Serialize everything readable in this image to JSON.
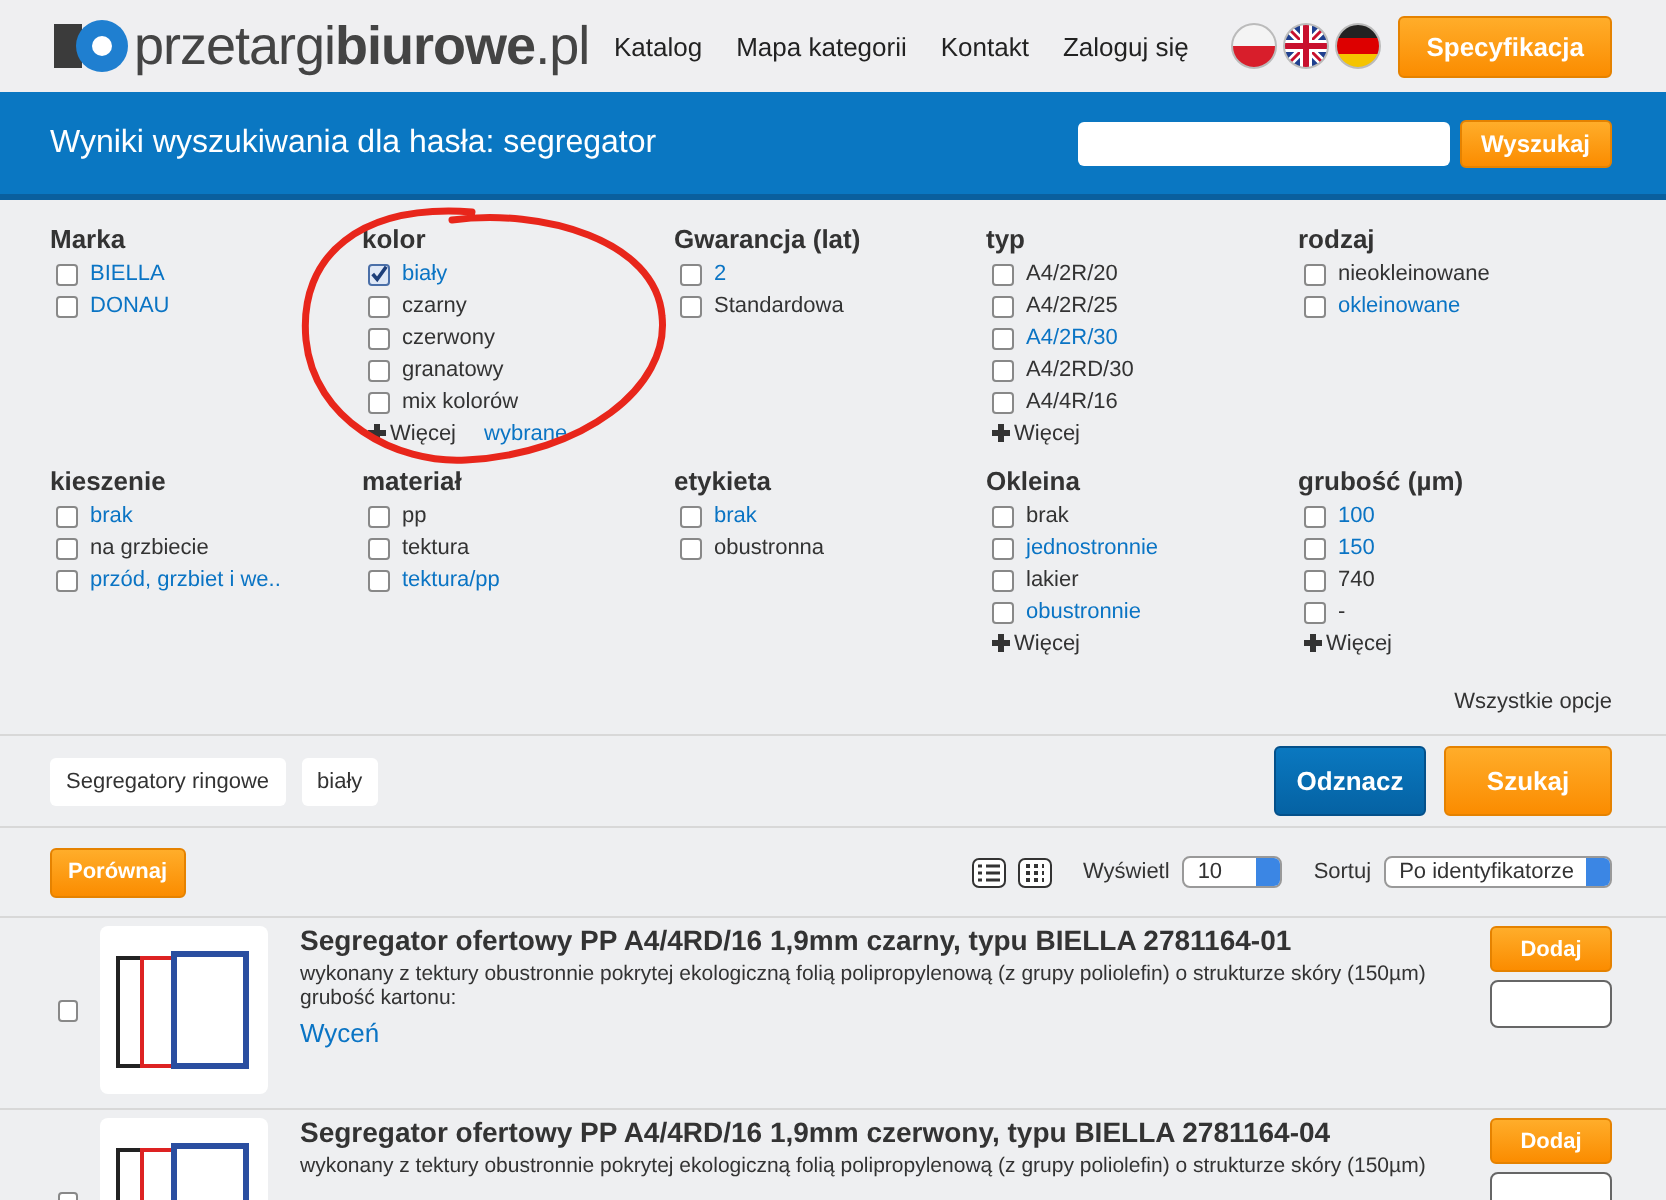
{
  "header": {
    "logo": "przetargi**biurowe**.pl",
    "nav": [
      "Katalog",
      "Mapa kategorii",
      "Kontakt",
      "Zaloguj się"
    ],
    "flags": [
      {
        "kind": "pl"
      },
      {
        "kind": "gb"
      },
      {
        "kind": "de"
      }
    ],
    "spec_button": "Specyfikacja"
  },
  "search_bar": {
    "title": "Wyniki wyszukiwania dla hasła: segregator",
    "button": "Wyszukaj"
  },
  "filters": [
    {
      "title": "Marka",
      "items": [
        {
          "label": "BIELLA",
          "checked": false,
          "linked": true
        },
        {
          "label": "DONAU",
          "checked": false,
          "linked": true
        }
      ]
    },
    {
      "title": "kolor",
      "circled": true,
      "items": [
        {
          "label": "biały",
          "checked": true,
          "linked": true
        },
        {
          "label": "czarny",
          "checked": false,
          "linked": false
        },
        {
          "label": "czerwony",
          "checked": false,
          "linked": false
        },
        {
          "label": "granatowy",
          "checked": false,
          "linked": false
        },
        {
          "label": "mix kolorów",
          "checked": false,
          "linked": false
        }
      ],
      "more": "Więcej",
      "chosen": "wybrane"
    },
    {
      "title": "Gwarancja (lat)",
      "items": [
        {
          "label": "2",
          "checked": false,
          "linked": true
        },
        {
          "label": "Standardowa",
          "checked": false,
          "linked": false
        }
      ]
    },
    {
      "title": "typ",
      "items": [
        {
          "label": "A4/2R/20",
          "checked": false,
          "linked": false
        },
        {
          "label": "A4/2R/25",
          "checked": false,
          "linked": false
        },
        {
          "label": "A4/2R/30",
          "checked": false,
          "linked": true
        },
        {
          "label": "A4/2RD/30",
          "checked": false,
          "linked": false
        },
        {
          "label": "A4/4R/16",
          "checked": false,
          "linked": false
        }
      ],
      "more": "Więcej"
    },
    {
      "title": "rodzaj",
      "items": [
        {
          "label": "nieokleinowane",
          "checked": false,
          "linked": false
        },
        {
          "label": "okleinowane",
          "checked": false,
          "linked": true
        }
      ]
    },
    {
      "title": "kieszenie",
      "items": [
        {
          "label": "brak",
          "checked": false,
          "linked": true
        },
        {
          "label": "na grzbiecie",
          "checked": false,
          "linked": false
        },
        {
          "label": "przód, grzbiet i we..",
          "checked": false,
          "linked": true
        }
      ]
    },
    {
      "title": "materiał",
      "items": [
        {
          "label": "pp",
          "checked": false,
          "linked": false
        },
        {
          "label": "tektura",
          "checked": false,
          "linked": false
        },
        {
          "label": "tektura/pp",
          "checked": false,
          "linked": true
        }
      ]
    },
    {
      "title": "etykieta",
      "items": [
        {
          "label": "brak",
          "checked": false,
          "linked": true
        },
        {
          "label": "obustronna",
          "checked": false,
          "linked": false
        }
      ]
    },
    {
      "title": "Okleina",
      "items": [
        {
          "label": "brak",
          "checked": false,
          "linked": false
        },
        {
          "label": "jednostronnie",
          "checked": false,
          "linked": true
        },
        {
          "label": "lakier",
          "checked": false,
          "linked": false
        },
        {
          "label": "obustronnie",
          "checked": false,
          "linked": true
        }
      ],
      "more": "Więcej"
    },
    {
      "title": "grubość (µm)",
      "items": [
        {
          "label": "100",
          "checked": false,
          "linked": true
        },
        {
          "label": "150",
          "checked": false,
          "linked": true
        },
        {
          "label": "740",
          "checked": false,
          "linked": false
        },
        {
          "label": "-",
          "checked": false,
          "linked": false
        }
      ],
      "more": "Więcej"
    }
  ],
  "all_options": "Wszystkie opcje",
  "chips": [
    "Segregatory ringowe",
    "biały"
  ],
  "actions": {
    "clear": "Odznacz",
    "search": "Szukaj"
  },
  "toolbar": {
    "compare": "Porównaj",
    "show_label": "Wyświetl",
    "show_value": "10",
    "sort_label": "Sortuj",
    "sort_value": "Po identyfikatorze"
  },
  "products": [
    {
      "title": "Segregator ofertowy PP A4/4RD/16 1,9mm czarny, typu BIELLA 2781164-01",
      "description": "wykonany z tektury obustronnie pokrytej ekologiczną folią polipropylenową (z grupy poliolefin) o strukturze skóry (150µm) grubość kartonu:",
      "link": "Wyceń",
      "button": "Dodaj",
      "checked": false
    },
    {
      "title": "Segregator ofertowy PP A4/4RD/16 1,9mm czerwony, typu BIELLA 2781164-04",
      "description": "wykonany z tektury obustronnie pokrytej ekologiczną folią polipropylenową (z grupy poliolefin) o strukturze skóry (150µm)",
      "button": "Dodaj",
      "checked": false
    }
  ]
}
